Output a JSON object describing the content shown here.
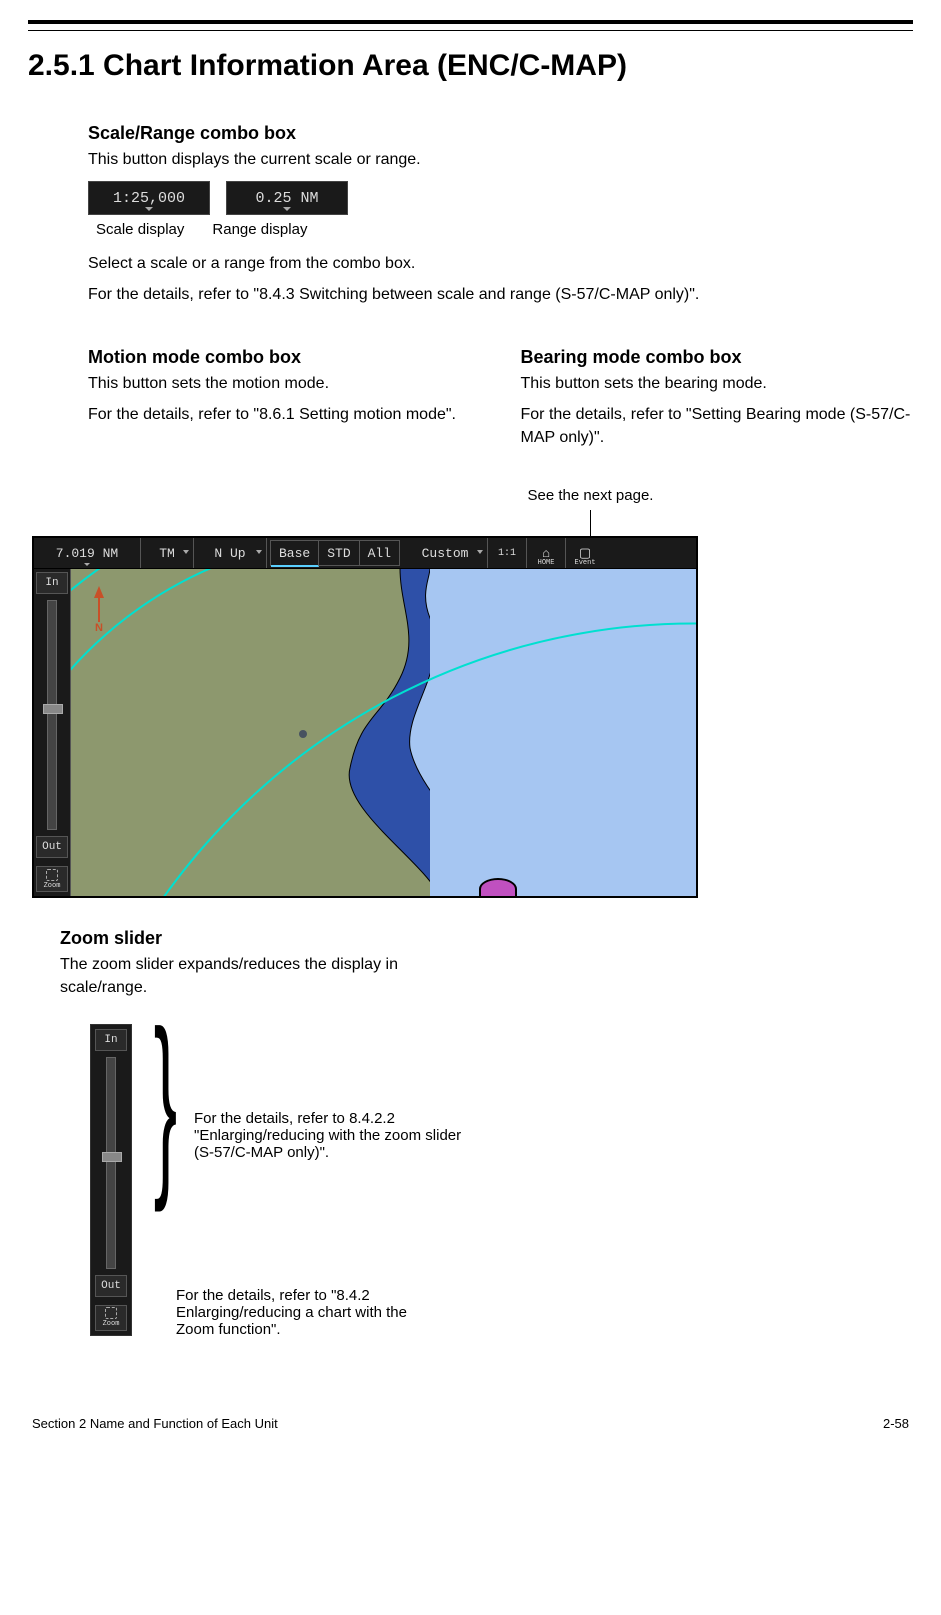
{
  "title": "2.5.1   Chart Information Area (ENC/C-MAP)",
  "scale_range": {
    "heading": "Scale/Range combo box",
    "desc": "This button displays the current scale or range.",
    "scale_value": "1:25,000",
    "range_value": "0.25 NM",
    "scale_caption": "Scale display",
    "range_caption": "Range display",
    "select_line1": "Select a scale or a range from the combo box.",
    "select_line2": "For the details, refer to \"8.4.3 Switching between scale and range (S-57/C-MAP only)\"."
  },
  "motion": {
    "heading": "Motion mode combo box",
    "l1": "This button sets the motion mode.",
    "l2": "For the details, refer to \"8.6.1 Setting motion mode\"."
  },
  "bearing": {
    "heading": "Bearing mode combo box",
    "l1": "This button sets the bearing mode.",
    "l2": "For the details, refer to \"Setting Bearing mode (S-57/C-MAP only)\"."
  },
  "see_next": "See the next page.",
  "chart_bar": {
    "range": "7.019 NM",
    "tm": "TM",
    "nup": "N Up",
    "base": "Base",
    "std": "STD",
    "all": "All",
    "custom": "Custom",
    "home": "HOME",
    "event": "Event"
  },
  "zoom": {
    "in": "In",
    "out": "Out",
    "zoom_label": "Zoom"
  },
  "north_label": "N",
  "zoom_slider": {
    "heading": "Zoom slider",
    "desc": "The zoom slider expands/reduces the display in scale/range.",
    "note_mid": "For the details, refer to 8.4.2.2 \"Enlarging/reducing with the zoom slider (S-57/C-MAP only)\".",
    "note_bot": "For the details, refer to \"8.4.2 Enlarging/reducing a chart with the Zoom function\"."
  },
  "footer": {
    "left": "Section 2    Name and Function of Each Unit",
    "right": "2-58"
  }
}
